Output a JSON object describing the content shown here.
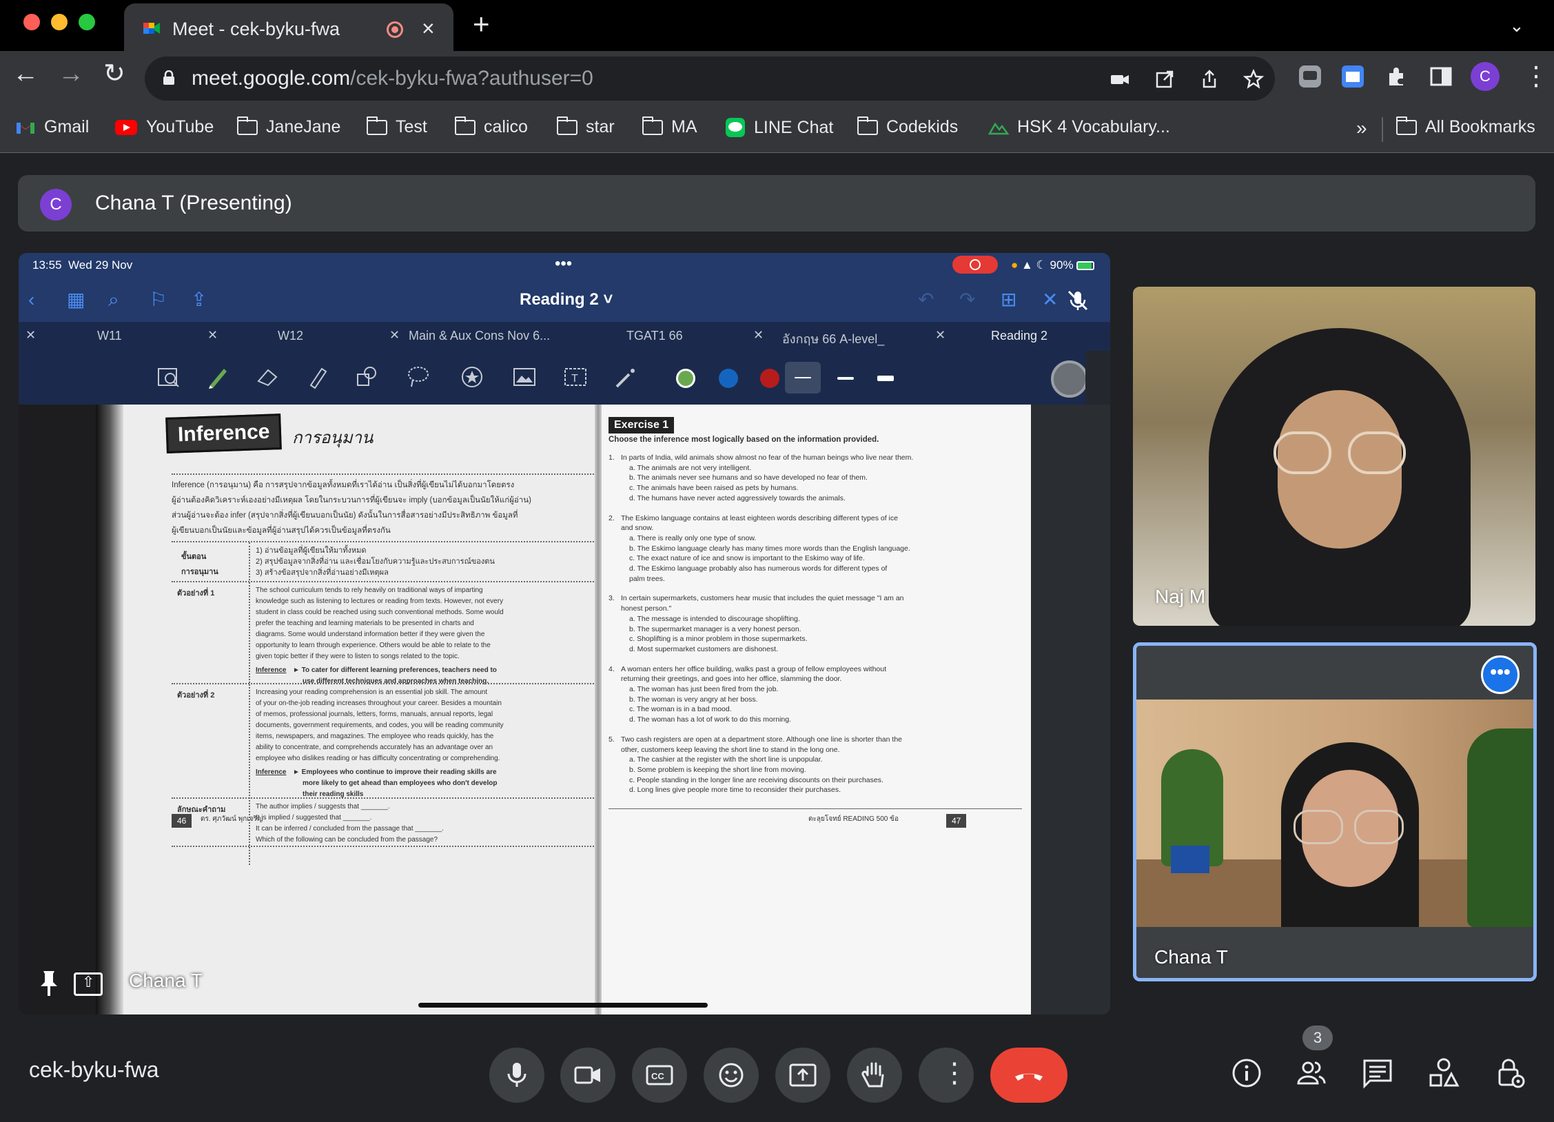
{
  "browser": {
    "tab": {
      "title": "Meet - cek-byku-fwa"
    },
    "url": {
      "host": "meet.google.com",
      "path": "/cek-byku-fwa?authuser=0"
    },
    "profile_initial": "C",
    "bookmarks": [
      {
        "label": "Gmail",
        "icon": "gmail-icon"
      },
      {
        "label": "YouTube",
        "icon": "youtube-icon"
      },
      {
        "label": "JaneJane",
        "icon": "folder-icon"
      },
      {
        "label": "Test",
        "icon": "folder-icon"
      },
      {
        "label": "calico",
        "icon": "folder-icon"
      },
      {
        "label": "star",
        "icon": "folder-icon"
      },
      {
        "label": "MA",
        "icon": "folder-icon"
      },
      {
        "label": "LINE Chat",
        "icon": "line-icon"
      },
      {
        "label": "Codekids",
        "icon": "folder-icon"
      },
      {
        "label": "HSK 4 Vocabulary...",
        "icon": "hsk-icon"
      }
    ],
    "overflow_label": "»",
    "all_bookmarks": "All Bookmarks"
  },
  "meet": {
    "presenter": {
      "initial": "C",
      "label": "Chana T (Presenting)"
    },
    "meeting_code": "cek-byku-fwa",
    "participant_count": "3",
    "tiles": [
      {
        "name": "Naj M"
      },
      {
        "name": "Chana T"
      }
    ],
    "screen_owner": "Chana T"
  },
  "ipad": {
    "time": "13:55",
    "date": "Wed 29 Nov",
    "battery": "90%",
    "doc_title": "Reading 2",
    "doc_tabs": [
      "W11",
      "W12",
      "Main & Aux Cons Nov 6...",
      "TGAT1 66",
      "อังกฤษ 66 A-level_",
      "Reading 2"
    ],
    "colors": {
      "green": "#6aa84f",
      "blue": "#1565c0",
      "red": "#b71c1c"
    }
  },
  "book": {
    "left": {
      "badge": "Inference",
      "thai_title": "การอนุมาน",
      "intro": [
        "Inference (การอนุมาน) คือ การสรุปจากข้อมูลทั้งหมดที่เราได้อ่าน เป็นสิ่งที่ผู้เขียนไม่ได้บอกมาโดยตรง",
        "ผู้อ่านต้องคิดวิเคราะห์เองอย่างมีเหตุผล โดยในกระบวนการที่ผู้เขียนจะ imply (บอกข้อมูลเป็นนัยให้แก่ผู้อ่าน)",
        "ส่วนผู้อ่านจะต้อง infer (สรุปจากสิ่งที่ผู้เขียนบอกเป็นนัย) ดังนั้นในการสื่อสารอย่างมีประสิทธิภาพ ข้อมูลที่",
        "ผู้เขียนบอกเป็นนัยและข้อมูลที่ผู้อ่านสรุปได้ควรเป็นข้อมูลที่ตรงกัน"
      ],
      "steps_label": [
        "ขั้นตอน",
        "การอนุมาน"
      ],
      "steps": [
        "1)  อ่านข้อมูลที่ผู้เขียนให้มาทั้งหมด",
        "2)  สรุปข้อมูลจากสิ่งที่อ่าน และเชื่อมโยงกับความรู้และประสบการณ์ของตน",
        "3)  สร้างข้อสรุปจากสิ่งที่อ่านอย่างมีเหตุผล"
      ],
      "example1_label": "ตัวอย่างที่ 1",
      "example1": [
        "The school curriculum tends to rely heavily on traditional ways of imparting",
        "knowledge such as listening to lectures or reading from texts. However, not every",
        "student in class could be reached using such conventional methods. Some would",
        "prefer the teaching and learning materials to be presented in charts and",
        "diagrams. Some would understand information better if they were given the",
        "opportunity to learn through experience. Others would be able to relate to the",
        "given topic better if they were to listen to songs related to the topic."
      ],
      "inference1_label": "Inference",
      "inference1": [
        "► To cater for different learning preferences, teachers need to",
        "use different techniques and approaches when teaching."
      ],
      "example2_label": "ตัวอย่างที่ 2",
      "example2": [
        "Increasing your reading comprehension is an essential job skill. The amount",
        "of your on-the-job reading increases throughout your career. Besides a mountain",
        "of memos, professional journals, letters, forms, manuals, annual reports, legal",
        "documents, government requirements, and codes, you will be reading community",
        "items, newspapers, and magazines. The employee who reads quickly, has the",
        "ability to concentrate, and comprehends accurately has an advantage over an",
        "employee who dislikes reading or has difficulty concentrating or comprehending."
      ],
      "inference2_label": "Inference",
      "inference2": [
        "► Employees who continue to improve their reading skills are",
        "more likely to get ahead than employees who don't develop",
        "their reading skills"
      ],
      "question_label": "ลักษณะคำถาม",
      "questions": [
        "The author implies / suggests that _______.",
        "It is implied / suggested that _______.",
        "It can be inferred / concluded from the passage that _______.",
        "Which of the following can be concluded from the passage?"
      ],
      "page_number": "46",
      "footer": "ดร. ศุภวัฒน์ พุกเจริญ"
    },
    "right": {
      "badge": "Exercise 1",
      "instruction": "Choose the inference most logically based on the information provided.",
      "questions": [
        {
          "num": "1.",
          "stem": [
            "In parts of India, wild animals show almost no fear of the human beings who live near them."
          ],
          "options": [
            "a.   The animals are not very intelligent.",
            "b.   The animals never see humans and so have developed no fear of them.",
            "c.   The animals have been raised as pets by humans.",
            "d.   The humans have never acted aggressively towards the animals."
          ]
        },
        {
          "num": "2.",
          "stem": [
            "The Eskimo language contains at least eighteen words describing different types of ice",
            "and snow."
          ],
          "options": [
            "a.   There is really only one type of snow.",
            "b.   The Eskimo language clearly has many times more words than the English language.",
            "c.   The exact nature of ice and snow is important to the Eskimo way of life.",
            "d.   The Eskimo language probably also has numerous words for different types of",
            "      palm trees."
          ]
        },
        {
          "num": "3.",
          "stem": [
            "In certain supermarkets, customers hear music that includes the quiet message \"I am an",
            "honest person.\""
          ],
          "options": [
            "a.   The message is intended to discourage shoplifting.",
            "b.   The supermarket manager is a very honest person.",
            "c.   Shoplifting is a minor problem in those supermarkets.",
            "d.   Most supermarket customers are dishonest."
          ]
        },
        {
          "num": "4.",
          "stem": [
            "A woman enters her office building, walks past a group of fellow employees without",
            "returning their greetings, and goes into her office, slamming the door."
          ],
          "options": [
            "a.   The woman has just been fired from the job.",
            "b.   The woman is very angry at her boss.",
            "c.   The woman is in a bad mood.",
            "d.   The woman has a lot of work to do this morning."
          ]
        },
        {
          "num": "5.",
          "stem": [
            "Two cash registers are open at a department store. Although one line is shorter than the",
            "other, customers keep leaving the short line to stand in the long one."
          ],
          "options": [
            "a.   The cashier at the register with the short line is unpopular.",
            "b.   Some problem is keeping the short line from moving.",
            "c.   People standing in the longer line are receiving discounts on their purchases.",
            "d.   Long lines give people more time to reconsider their purchases."
          ]
        }
      ],
      "footer": "ตะลุยโจทย์ READING 500 ข้อ",
      "page_number": "47"
    }
  }
}
